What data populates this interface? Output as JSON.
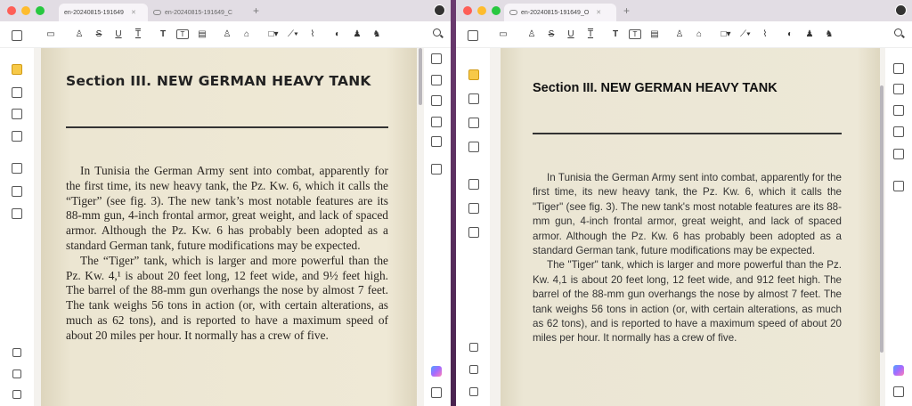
{
  "left_window": {
    "tabs": [
      {
        "label": "en-20240815-191649"
      },
      {
        "label": "en-20240815-191649_C"
      }
    ],
    "page": {
      "heading": "Section III. NEW GERMAN HEAVY TANK",
      "paragraph1": "In Tunisia the German Army sent into combat, apparently for the first time, its new heavy tank, the Pz. Kw. 6, which it calls the “Tiger” (see fig. 3). The new tank’s most notable features are its 88-mm gun, 4-inch frontal armor, great weight, and lack of spaced armor. Although the Pz. Kw. 6 has probably been adopted as a standard German tank, future modifications may be expected.",
      "paragraph2": "The “Tiger” tank, which is larger and more powerful than the Pz. Kw. 4,¹ is about 20 feet long, 12 feet wide, and 9½ feet high. The barrel of the 88-mm gun overhangs the nose by almost 7 feet. The tank weighs 56 tons in action (or, with certain alterations, as much as 62 tons), and is reported to have a maximum speed of about 20 miles per hour. It normally has a crew of five."
    }
  },
  "right_window": {
    "tabs": [
      {
        "label": "en-20240815-191649_O"
      }
    ],
    "page": {
      "heading": "Section III. NEW GERMAN HEAVY TANK",
      "paragraph1": "In Tunisia the German Army sent into combat, apparently for the first time, its new heavy tank, the Pz. Kw. 6, which it calls the \"Tiger\" (see fig. 3). The new tank's most notable features are its 88-mm gun, 4-inch frontal armor, great weight, and lack of spaced armor. Although the Pz. Kw. 6 has probably been adopted as a standard German tank, future modifications may be expected.",
      "paragraph2": "The \"Tiger\" tank, which is larger and more powerful than the Pz. Kw. 4,1 is about 20 feet long, 12 feet wide, and 912 feet high. The barrel of the 88-mm gun overhangs the nose by almost 7 feet. The tank weighs 56 tons in action (or, with certain alterations, as much as 62 tons), and is reported to have a maximum speed of about 20 miles per hour. It normally has a crew of five."
    }
  },
  "toolbar": {
    "s_label": "S",
    "u_label": "U",
    "t_label": "T",
    "text_label": "T"
  },
  "colors": {
    "highlight_tool": "#f7c948",
    "traffic_red": "#fe5f57",
    "traffic_yellow": "#febc2e",
    "traffic_green": "#28c840"
  }
}
